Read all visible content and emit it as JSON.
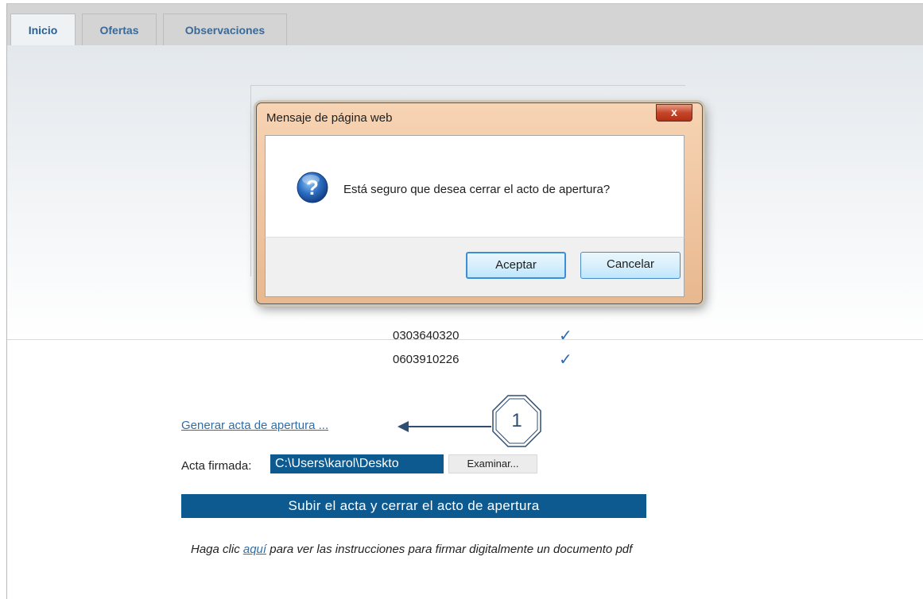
{
  "tabs": [
    {
      "label": "Inicio",
      "active": true
    },
    {
      "label": "Ofertas",
      "active": false
    },
    {
      "label": "Observaciones",
      "active": false
    }
  ],
  "list": {
    "rows": [
      {
        "id": "0303640320",
        "checked": true
      },
      {
        "id": "0603910226",
        "checked": true
      }
    ],
    "check_glyph": "✓"
  },
  "generate_link": "Generar acta de apertura ...",
  "callout_number": "1",
  "signed_act": {
    "label": "Acta firmada:",
    "file_value": "C:\\Users\\karol\\Deskto",
    "browse_button": "Examinar..."
  },
  "upload_button": "Subir el acta y cerrar el acto de apertura",
  "instructions": {
    "prefix": "Haga clic ",
    "link": "aquí",
    "suffix": " para ver las instrucciones para firmar digitalmente un documento pdf"
  },
  "dialog": {
    "title": "Mensaje de página web",
    "close_glyph": "x",
    "message": "Está seguro que desea cerrar el acto de apertura?",
    "icon": "question-icon",
    "accept_label": "Aceptar",
    "cancel_label": "Cancelar"
  },
  "colors": {
    "primary_blue": "#0d5a91",
    "link_blue": "#2f6ea8",
    "tab_text": "#3a6a97",
    "check_blue": "#2d6ab5"
  }
}
